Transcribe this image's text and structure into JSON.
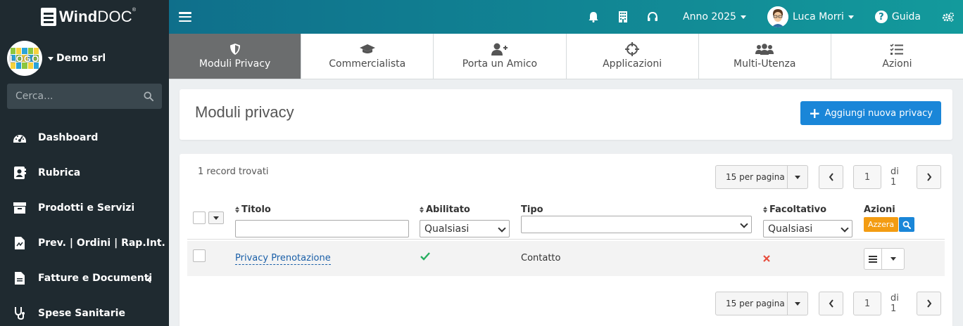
{
  "brand": {
    "name_bold": "Wind",
    "name_light": "DOC",
    "trademark": "®"
  },
  "company": {
    "logo_text": "LOGO",
    "name": "Demo srl"
  },
  "search": {
    "placeholder": "Cerca..."
  },
  "sidebar": {
    "items": [
      {
        "label": "Dashboard",
        "icon": "gauge-icon"
      },
      {
        "label": "Rubrica",
        "icon": "address-book-icon"
      },
      {
        "label": "Prodotti e Servizi",
        "icon": "box-icon"
      },
      {
        "label": "Prev. | Ordini | Rap.Int.",
        "icon": "document-icon"
      },
      {
        "label": "Fatture e Documenti",
        "icon": "file-icon"
      },
      {
        "label": "Spese Sanitarie",
        "icon": "stethoscope-icon"
      }
    ]
  },
  "topbar": {
    "year": "Anno 2025",
    "user": "Luca Morri",
    "help": "Guida"
  },
  "tabs": [
    {
      "label": "Moduli Privacy",
      "icon": "shield-icon",
      "active": true
    },
    {
      "label": "Commercialista",
      "icon": "graduation-cap-icon",
      "active": false
    },
    {
      "label": "Porta un Amico",
      "icon": "user-plus-icon",
      "active": false
    },
    {
      "label": "Applicazioni",
      "icon": "crosshair-icon",
      "active": false
    },
    {
      "label": "Multi-Utenza",
      "icon": "users-icon",
      "active": false
    },
    {
      "label": "Azioni",
      "icon": "tasks-icon",
      "active": false
    }
  ],
  "page": {
    "title": "Moduli privacy",
    "add_button": "Aggiungi nuova privacy"
  },
  "list": {
    "records": "1 record trovati",
    "per_page": "15 per pagina",
    "page": "1",
    "of": "di 1",
    "columns": {
      "titolo": "Titolo",
      "abilitato": "Abilitato",
      "tipo": "Tipo",
      "facoltativo": "Facoltativo",
      "azioni": "Azioni"
    },
    "filters": {
      "abilitato": "Qualsiasi",
      "facoltativo": "Qualsiasi",
      "reset": "Azzera"
    },
    "rows": [
      {
        "titolo": "Privacy Prenotazione",
        "abilitato": true,
        "tipo": "Contatto",
        "facoltativo": false
      }
    ]
  },
  "colors": {
    "sidebar": "#1f2a30",
    "accent": "#1a86d8",
    "warning": "#f39c12",
    "success": "#27ae60",
    "danger": "#e74c3c"
  }
}
